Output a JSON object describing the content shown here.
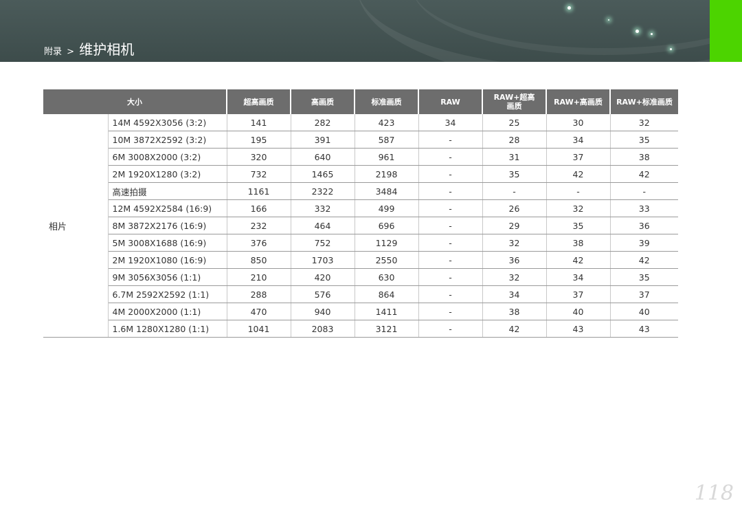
{
  "header": {
    "breadcrumb_parent": "附录",
    "separator": ">",
    "title": "维护相机"
  },
  "table": {
    "headers": [
      "大小",
      "超高画质",
      "高画质",
      "标准画质",
      "RAW",
      "RAW+超高\n画质",
      "RAW+高画质",
      "RAW+标准画质"
    ],
    "category": "相片",
    "rows": [
      [
        "14M 4592X3056 (3:2)",
        "141",
        "282",
        "423",
        "34",
        "25",
        "30",
        "32"
      ],
      [
        "10M 3872X2592 (3:2)",
        "195",
        "391",
        "587",
        "-",
        "28",
        "34",
        "35"
      ],
      [
        "6M 3008X2000 (3:2)",
        "320",
        "640",
        "961",
        "-",
        "31",
        "37",
        "38"
      ],
      [
        "2M 1920X1280 (3:2)",
        "732",
        "1465",
        "2198",
        "-",
        "35",
        "42",
        "42"
      ],
      [
        "高速拍摄",
        "1161",
        "2322",
        "3484",
        "-",
        "-",
        "-",
        "-"
      ],
      [
        "12M 4592X2584 (16:9)",
        "166",
        "332",
        "499",
        "-",
        "26",
        "32",
        "33"
      ],
      [
        "8M 3872X2176 (16:9)",
        "232",
        "464",
        "696",
        "-",
        "29",
        "35",
        "36"
      ],
      [
        "5M 3008X1688 (16:9)",
        "376",
        "752",
        "1129",
        "-",
        "32",
        "38",
        "39"
      ],
      [
        "2M 1920X1080 (16:9)",
        "850",
        "1703",
        "2550",
        "-",
        "36",
        "42",
        "42"
      ],
      [
        "9M 3056X3056 (1:1)",
        "210",
        "420",
        "630",
        "-",
        "32",
        "34",
        "35"
      ],
      [
        "6.7M 2592X2592 (1:1)",
        "288",
        "576",
        "864",
        "-",
        "34",
        "37",
        "37"
      ],
      [
        "4M 2000X2000 (1:1)",
        "470",
        "940",
        "1411",
        "-",
        "38",
        "40",
        "40"
      ],
      [
        "1.6M 1280X1280 (1:1)",
        "1041",
        "2083",
        "3121",
        "-",
        "42",
        "43",
        "43"
      ]
    ]
  },
  "page_number": "118",
  "colors": {
    "header_bg": "#3d4c4b",
    "accent_tab": "#4cd400",
    "table_header_bg": "#6d6d6d"
  }
}
